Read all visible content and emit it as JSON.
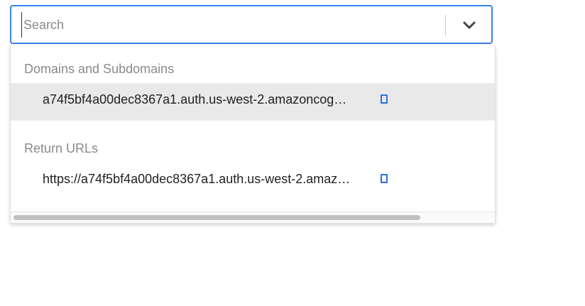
{
  "search": {
    "placeholder": "Search",
    "value": "",
    "toggle_icon": "chevron-down-icon"
  },
  "dropdown": {
    "groups": [
      {
        "label": "Domains and Subdomains",
        "options": [
          {
            "text": "a74f5bf4a00dec8367a1.auth.us-west-2.amazoncog…",
            "highlighted": true,
            "icon": "copy-icon"
          }
        ]
      },
      {
        "label": "Return URLs",
        "options": [
          {
            "text": "https://a74f5bf4a00dec8367a1.auth.us-west-2.amaz…",
            "highlighted": false,
            "icon": "copy-icon"
          }
        ]
      }
    ],
    "scrollbar": {
      "thumb_fraction": 0.85,
      "position": 0.0
    }
  },
  "colors": {
    "focus_border": "#3b82e6",
    "icon_blue": "#2f6fd6",
    "highlight_bg": "#e9e9e9",
    "group_label": "#8a8a8a"
  }
}
